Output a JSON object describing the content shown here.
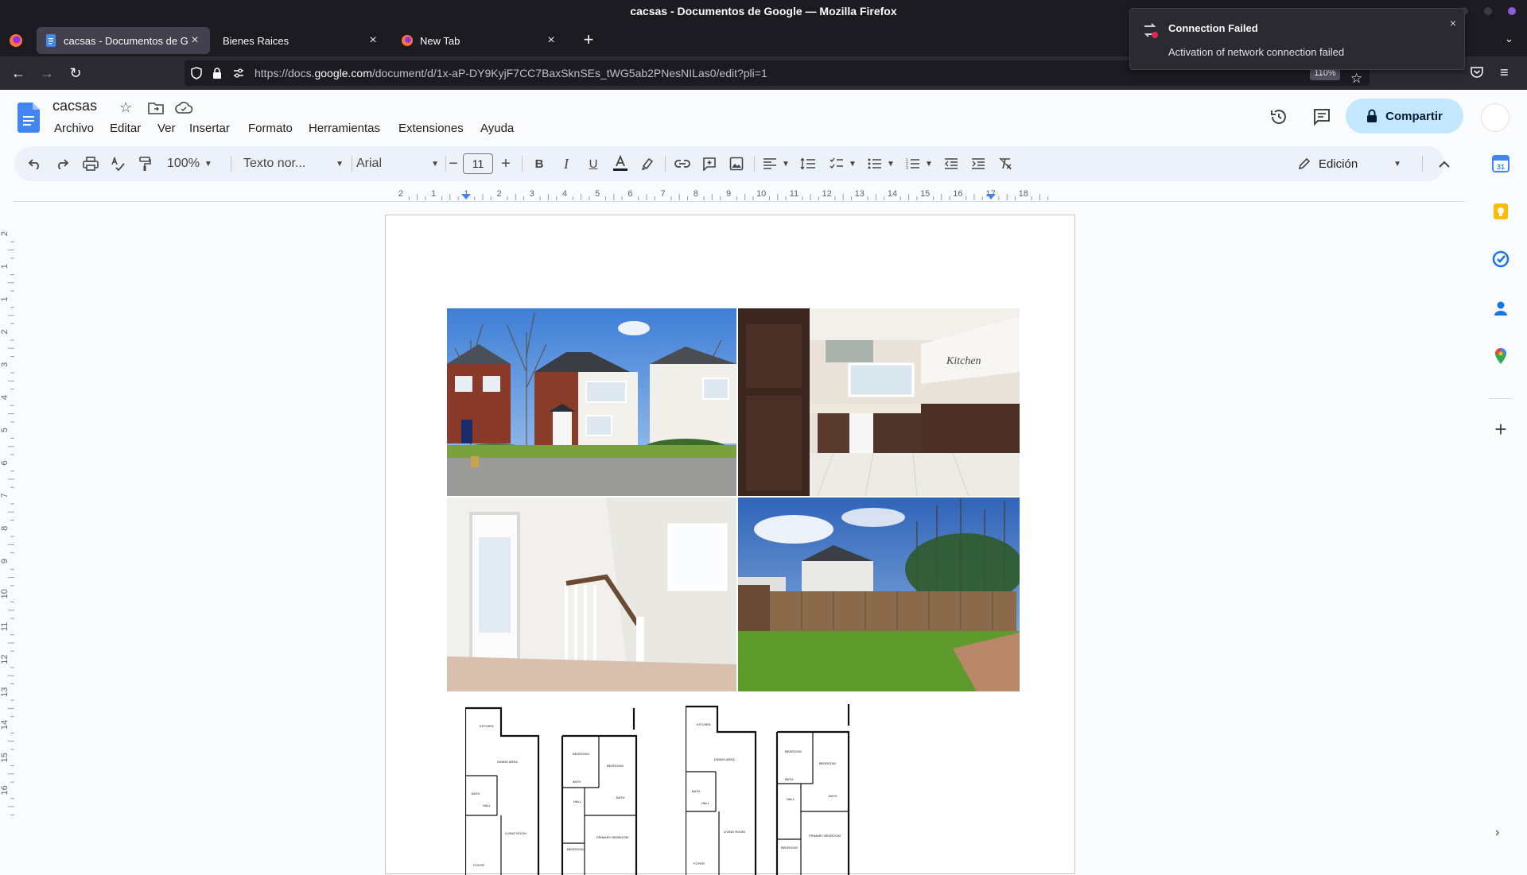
{
  "window": {
    "title": "cacsas - Documentos de Google — Mozilla Firefox"
  },
  "tabs": [
    {
      "label": "cacsas - Documentos de Goo",
      "active": true
    },
    {
      "label": "Bienes Raices",
      "active": false
    },
    {
      "label": "New Tab",
      "active": false
    }
  ],
  "url": {
    "prefix": "https://docs.",
    "host": "google.com",
    "path": "/document/d/1x-aP-DY9KyjF7CC7BaxSknSEs_tWG5ab2PNesNILas0/edit?pli=1",
    "zoom": "110%"
  },
  "notification": {
    "title": "Connection Failed",
    "body": "Activation of network connection failed"
  },
  "doc": {
    "title": "cacsas"
  },
  "menu": [
    "Archivo",
    "Editar",
    "Ver",
    "Insertar",
    "Formato",
    "Herramientas",
    "Extensiones",
    "Ayuda"
  ],
  "share": {
    "label": "Compartir"
  },
  "toolbar": {
    "zoom": "100%",
    "style": "Texto nor...",
    "font": "Arial",
    "font_size": "11",
    "mode": "Edición"
  },
  "ruler": {
    "h_ticks": [
      "2",
      "1",
      "1",
      "2",
      "3",
      "4",
      "5",
      "6",
      "7",
      "8",
      "9",
      "10",
      "11",
      "12",
      "13",
      "14",
      "15",
      "16",
      "17",
      "18"
    ],
    "v_ticks": [
      "2",
      "1",
      "1",
      "2",
      "3",
      "4",
      "5",
      "6",
      "7",
      "8",
      "9",
      "10",
      "11",
      "12",
      "13",
      "14",
      "15",
      "16"
    ]
  },
  "floor_plan_labels": {
    "left_ground": [
      "KITCHEN",
      "DINING AREA",
      "BATH",
      "HALL",
      "LIVING ROOM",
      "FOYER"
    ],
    "left_upper": [
      "BEDROOM",
      "BEDROOM",
      "BATH",
      "HALL",
      "BATH",
      "PRIMARY BEDROOM",
      "BEDROOM"
    ],
    "right_ground": [
      "KITCHEN",
      "DINING AREA",
      "BATH",
      "HALL",
      "LIVING ROOM",
      "FOYER"
    ],
    "right_upper": [
      "BEDROOM",
      "BEDROOM",
      "BATH",
      "HALL",
      "BATH",
      "PRIMARY BEDROOM",
      "BEDROOM"
    ]
  },
  "colors": {
    "accent": "#0b57d0",
    "share_bg": "#c2e7ff",
    "toolbar_bg": "#edf2fa"
  }
}
